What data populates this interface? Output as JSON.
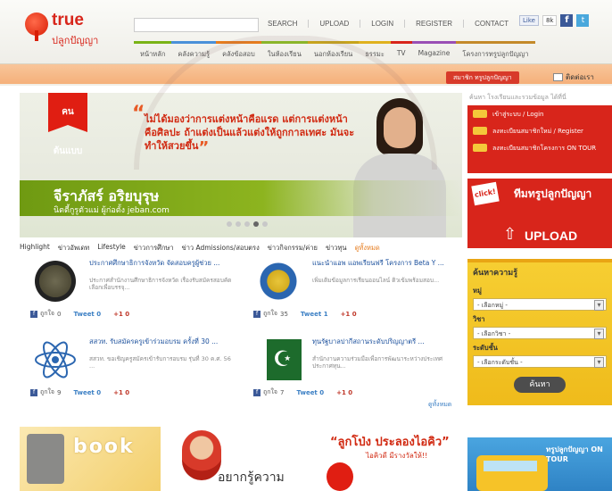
{
  "logo": {
    "brand": "true",
    "sub": "ปลูกปัญญา"
  },
  "top_links": [
    "SEARCH",
    "UPLOAD",
    "LOGIN",
    "REGISTER",
    "CONTACT"
  ],
  "social": {
    "like_label": "Like",
    "like_count": "8k",
    "fb_label": "f",
    "tw_label": "t"
  },
  "main_nav": [
    {
      "label": "หน้าหลัก",
      "color": "#7ab317"
    },
    {
      "label": "คลังความรู้",
      "color": "#4a90d9"
    },
    {
      "label": "คลังข้อสอบ",
      "color": "#e67c1e"
    },
    {
      "label": "ในห้องเรียน",
      "color": "#8bb52a"
    },
    {
      "label": "นอกห้องเรียน",
      "color": "#c7a41c"
    },
    {
      "label": "ธรรมะ",
      "color": "#e0b11e"
    },
    {
      "label": "TV",
      "color": "#d8251b"
    },
    {
      "label": "Magazine",
      "color": "#9a4fb5"
    },
    {
      "label": "โครงการทรูปลูกปัญญา",
      "color": "#c48a2a"
    }
  ],
  "ribbon": {
    "member_label": "สมาชิก ทรูปลูกปัญญา",
    "contact_label": "ติดต่อเรา"
  },
  "hero": {
    "tag": "คนต้นแบบ",
    "quote": "ไม่ได้มองว่าการแต่งหน้าคือแรด แต่การแต่งหน้าคือศิลปะ ถ้าแต่งเป็นแล้วแต่งให้ถูกกาลเทศะ มันจะทำให้สวยขึ้น",
    "name": "จีราภัสร์ อริยบุรุษ",
    "role": "นิตตี้กูรูตัวแม่ ผู้ก่อตั้ง jeban.com"
  },
  "category_tabs": [
    "Highlight",
    "ข่าวอัพเดท",
    "Lifestyle",
    "ข่าวการศึกษา",
    "ข่าว Admissions/สอบตรง",
    "ข่าวกิจกรรม/ค่าย",
    "ข่าวทุน",
    "ดูทั้งหมด"
  ],
  "news": [
    {
      "title": "ประกาศศึกษาธิการจังหวัด จัดสอบครูผู้ช่วย ...",
      "desc": "ประกาศสำนักงานศึกษาธิการจังหวัด เรื่องรับสมัครสอบคัดเลือกเพื่อบรรจุ...",
      "likes": "0",
      "tweets": "0",
      "plus": "0"
    },
    {
      "title": "แนะนำแอพ แอพเรียนฟรี โครงการ Beta Y ...",
      "desc": "เพิ่มเติมข้อมูลการเรียนออนไลน์ ติวเข้มพร้อมสอบ...",
      "likes": "35",
      "tweets": "1",
      "plus": "0"
    },
    {
      "title": "สสวท. รับสมัครครูเข้าร่วมอบรม ครั้งที่ 30 ...",
      "desc": "สสวท. ขอเชิญครูสมัครเข้ารับการอบรม รุ่นที่ 30 ค.ศ. 56 ...",
      "likes": "9",
      "tweets": "0",
      "plus": "0"
    },
    {
      "title": "ทุนรัฐบาลปากีสถานระดับปริญญาตรี ...",
      "desc": "สำนักงานความร่วมมือเพื่อการพัฒนาระหว่างประเทศ ประกาศทุน...",
      "likes": "7",
      "tweets": "0",
      "plus": "0"
    }
  ],
  "share_labels": {
    "fb": "ถูกใจ",
    "tweet": "Tweet",
    "gplus": "+1"
  },
  "more_label": "ดูทั้งหมด",
  "banners": {
    "book_title": "book",
    "mascot_text": "อยากรู้ความ",
    "promo_title": "“ลูกโป่ง ประลองไอคิว”",
    "promo_sub": "ไอคิวดี มีรางวัลให้!!"
  },
  "sidebar": {
    "head": "ค้นหา โรงเรียนและรวมข้อมูล ได้ที่นี่",
    "login_rows": [
      "เข้าสู่ระบบ / Login",
      "ลงทะเบียนสมาชิกใหม่ / Register",
      "ลงทะเบียนสมาชิกโครงการ ON TOUR"
    ],
    "click_label": "click!",
    "upload_title": "ทีมทรูปลูกปัญญา",
    "upload_label": "UPLOAD",
    "search_title": "ค้นหาความรู้",
    "filters": [
      {
        "label": "หมู่",
        "value": "- เลือกหมู่ -"
      },
      {
        "label": "วิชา",
        "value": "- เลือกวิชา -"
      },
      {
        "label": "ระดับชั้น",
        "value": "- เลือกระดับชั้น -"
      }
    ],
    "search_button": "ค้นหา",
    "tour_text": "ทรูปลูกปัญญา ON TOUR"
  }
}
